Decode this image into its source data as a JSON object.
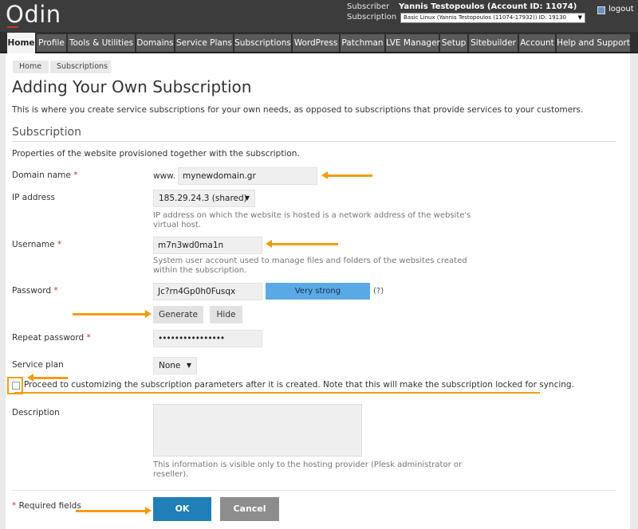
{
  "header": {
    "logo_text": "Odin",
    "subscriber_label": "Subscriber",
    "subscriber_value": "Yannis Testopoulos (Account ID: 11074)",
    "subscription_label": "Subscription",
    "subscription_value": "Basic Linux (Yannis Testopoulos (11074-17932)) ID: 19130",
    "logout_label": "logout",
    "colors": {
      "bar": "#3c3c3c",
      "accent": "#c0392b"
    }
  },
  "nav": {
    "tabs": [
      {
        "label": "Home",
        "active": true
      },
      {
        "label": "Profile"
      },
      {
        "label": "Tools & Utilities"
      },
      {
        "label": "Domains"
      },
      {
        "label": "Service Plans"
      },
      {
        "label": "Subscriptions"
      },
      {
        "label": "WordPress"
      },
      {
        "label": "Patchman"
      },
      {
        "label": "LVE Manager"
      },
      {
        "label": "Setup"
      },
      {
        "label": "Sitebuilder"
      },
      {
        "label": "Account"
      },
      {
        "label": "Help and Support"
      }
    ]
  },
  "breadcrumb": [
    "Home",
    "Subscriptions"
  ],
  "page": {
    "title": "Adding Your Own Subscription",
    "intro": "This is where you create service subscriptions for your own needs, as opposed to subscriptions that provide services to your customers.",
    "section_title": "Subscription",
    "section_desc": "Properties of the website provisioned together with the subscription."
  },
  "form": {
    "domain": {
      "label": "Domain name",
      "prefix": "www.",
      "value": "mynewdomain.gr"
    },
    "ip": {
      "label": "IP address",
      "value": "185.29.24.3 (shared)",
      "hint": "IP address on which the website is hosted is a network address of the website's virtual host."
    },
    "username": {
      "label": "Username",
      "value": "m7n3wd0ma1n",
      "hint": "System user account used to manage files and folders of the websites created within the subscription."
    },
    "password": {
      "label": "Password",
      "value": "Jc?rn4Gp0h0Fusqx",
      "strength": "Very strong",
      "help": "(?)",
      "generate_label": "Generate",
      "hide_label": "Hide"
    },
    "repeat_password": {
      "label": "Repeat password",
      "value": "••••••••••••••••"
    },
    "service_plan": {
      "label": "Service plan",
      "value": "None"
    },
    "customize": {
      "checked": false,
      "label": "Proceed to customizing the subscription parameters after it is created. Note that this will make the subscription locked for syncing."
    },
    "description": {
      "label": "Description",
      "value": "",
      "hint": "This information is visible only to the hosting provider (Plesk administrator or reseller)."
    },
    "required_star": "*",
    "required_note": "Required fields",
    "ok_label": "OK",
    "cancel_label": "Cancel",
    "colors": {
      "ok": "#1f7fb6",
      "cancel": "#8d8d8d",
      "strength": "#5aa9e6",
      "annotation": "#f39c12"
    }
  }
}
